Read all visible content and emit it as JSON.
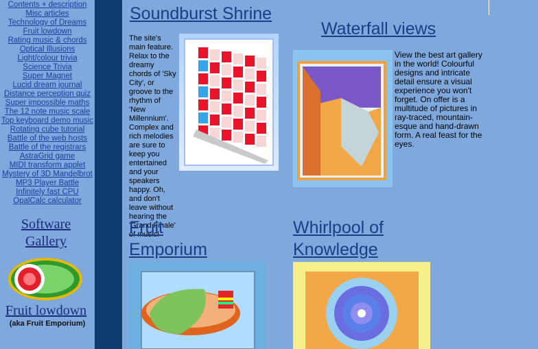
{
  "nav": {
    "items": [
      "Contents + description",
      "Misc articles",
      "Technology of Dreams",
      "Fruit lowdown",
      "Rating music & chords",
      "Optical Illusions",
      "Light/colour trivia",
      "Science Trivia",
      "Super Magnet",
      "Lucid dream journal",
      "Distance perception quiz",
      "Super impossible maths",
      "The 12 note music scale",
      "Top keyboard demo music",
      "Rotating cube tutorial",
      "Battle of the web hosts",
      "Battle of the registrars",
      "AstraGrid game",
      "MIDI transform applet",
      "Mystery of 3D Mandelbrot",
      "MP3 Player Battle",
      "Infinitely fast CPU",
      "OpalCalc calculator"
    ]
  },
  "sidebar": {
    "software_gallery": "Software Gallery",
    "fruit_lowdown": "Fruit lowdown",
    "aka": "(aka Fruit Emporium)"
  },
  "sections": {
    "soundburst": {
      "title": "Soundburst Shrine",
      "text": "The site's main feature. Relax to the dreamy chords of 'Sky City', or groove to the rhythm of 'New Millennium'. Complex and rich melodies are sure to keep you entertained and your speakers happy. Oh, and don't leave without hearing the 'Grand Finale' of music!"
    },
    "waterfall": {
      "title": "Waterfall views",
      "text": "View the best art gallery in the world! Colourful designs and intricate detail ensure a visual experience you won't forget. On offer is a multitude of pictures in ray-traced, mountain-esque and hand-drawn form. A real feast for the eyes."
    },
    "fruit": {
      "title": "Fruit Emporium"
    },
    "whirlpool": {
      "title": "Whirlpool of Knowledge"
    }
  },
  "colors": {
    "background": "#7fa9dd",
    "stripe": "#0e3a6e",
    "heading": "#1a3e86",
    "link": "#1a3d9e"
  }
}
